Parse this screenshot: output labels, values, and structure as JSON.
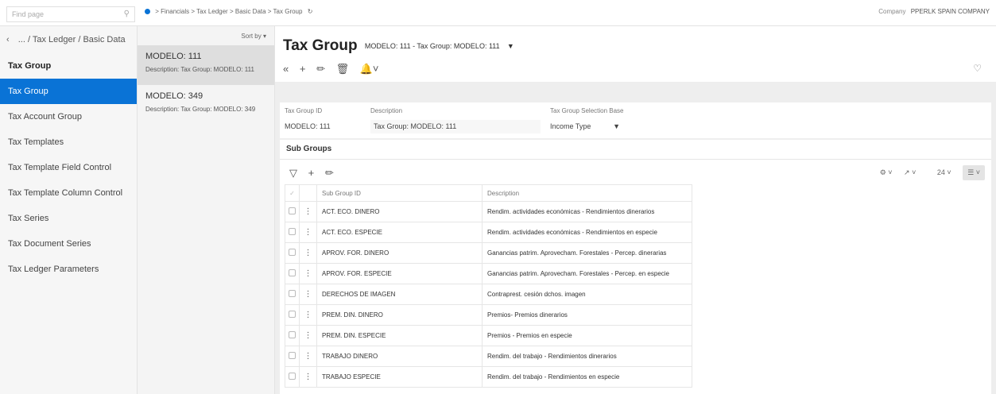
{
  "topbar": {
    "find_placeholder": "Find page",
    "breadcrumb": [
      "Financials",
      "Tax Ledger",
      "Basic Data",
      "Tax Group"
    ],
    "company_label": "Company",
    "company_value": "PPERLK SPAIN COMPANY"
  },
  "nav": {
    "back_label": "... / Tax Ledger / Basic Data",
    "header": "Tax Group",
    "items": [
      {
        "label": "Tax Group",
        "active": true
      },
      {
        "label": "Tax Account Group"
      },
      {
        "label": "Tax Templates"
      },
      {
        "label": "Tax Template Field Control"
      },
      {
        "label": "Tax Template Column Control"
      },
      {
        "label": "Tax Series"
      },
      {
        "label": "Tax Document Series"
      },
      {
        "label": "Tax Ledger Parameters"
      }
    ]
  },
  "records": {
    "sort_label": "Sort by",
    "items": [
      {
        "title": "MODELO: 111",
        "desc_label": "Description:",
        "desc": "Tax Group: MODELO: 111",
        "selected": true
      },
      {
        "title": "MODELO: 349",
        "desc_label": "Description:",
        "desc": "Tax Group: MODELO: 349"
      }
    ]
  },
  "page": {
    "title": "Tax Group",
    "subtitle": "MODELO: 111 - Tax Group: MODELO: 111"
  },
  "form": {
    "fields": [
      {
        "label": "Tax Group ID",
        "value": "MODELO: 111"
      },
      {
        "label": "Description",
        "value": "Tax Group: MODELO: 111"
      },
      {
        "label": "Tax Group Selection Base",
        "value": "Income Type"
      }
    ]
  },
  "subgroups": {
    "title": "Sub Groups",
    "page_size": "24",
    "columns": [
      "Sub Group ID",
      "Description"
    ],
    "rows": [
      [
        "ACT. ECO. DINERO",
        "Rendim. actividades económicas - Rendimientos dinerarios"
      ],
      [
        "ACT. ECO. ESPECIE",
        "Rendim. actividades económicas - Rendimientos en especie"
      ],
      [
        "APROV. FOR. DINERO",
        "Ganancias patrim. Aprovecham. Forestales - Percep. dinerarias"
      ],
      [
        "APROV. FOR. ESPECIE",
        "Ganancias patrim. Aprovecham. Forestales - Percep. en especie"
      ],
      [
        "DERECHOS DE IMAGEN",
        "Contraprest. cesión dchos. imagen"
      ],
      [
        "PREM. DIN. DINERO",
        "Premios- Premios dinerarios"
      ],
      [
        "PREM. DIN. ESPECIE",
        "Premios - Premios en especie"
      ],
      [
        "TRABAJO DINERO",
        "Rendim. del trabajo - Rendimientos dinerarios"
      ],
      [
        "TRABAJO ESPECIE",
        "Rendim. del trabajo - Rendimientos en especie"
      ]
    ]
  },
  "colors": {
    "accent": "#0a73d6"
  }
}
